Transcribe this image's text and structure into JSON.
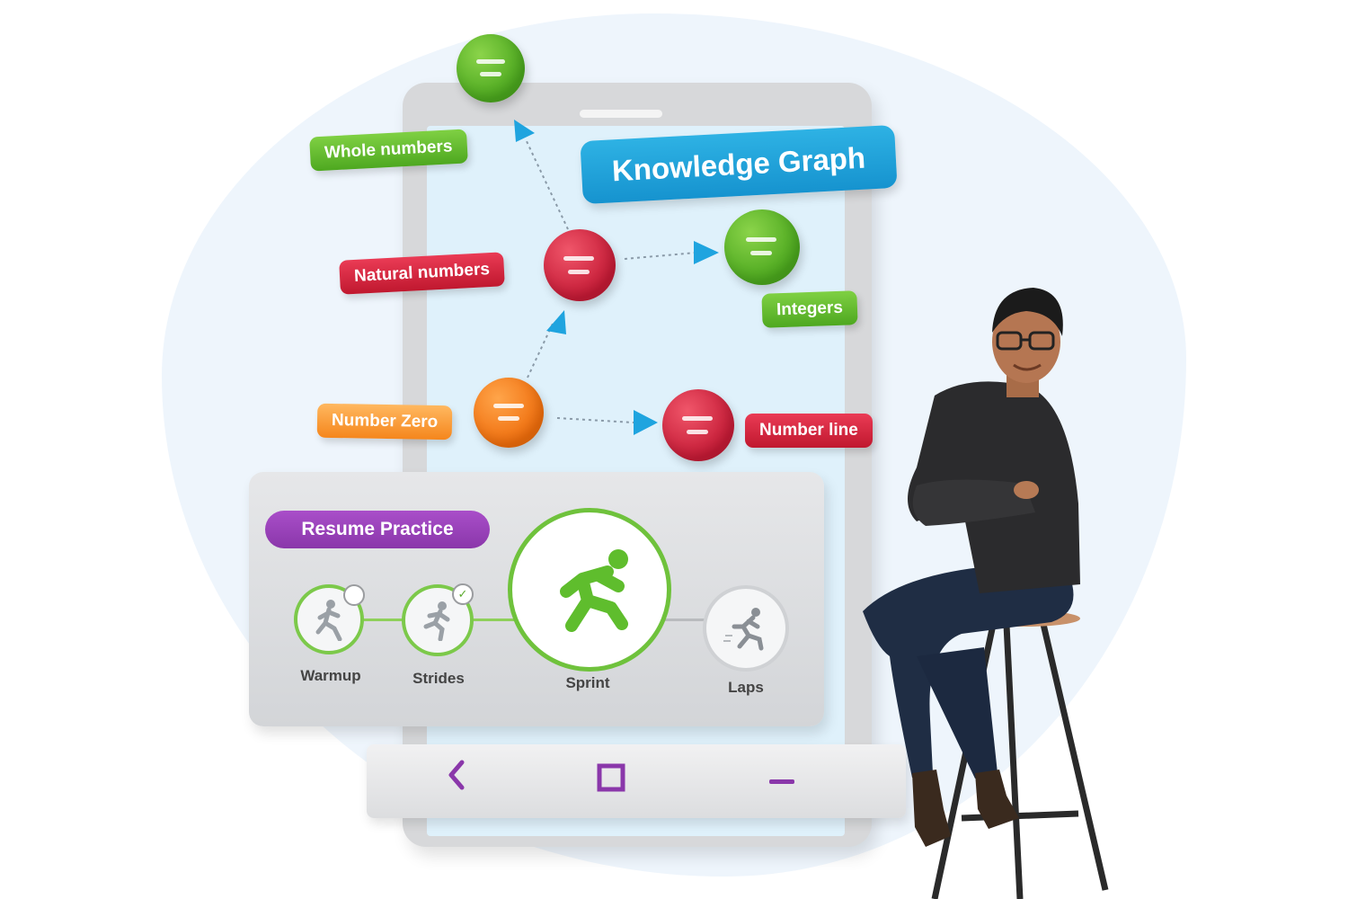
{
  "graph": {
    "title": "Knowledge Graph",
    "nodes": [
      {
        "id": "whole",
        "label": "Whole numbers",
        "color": "#5ab52a"
      },
      {
        "id": "natural",
        "label": "Natural numbers",
        "color": "#d3213c"
      },
      {
        "id": "integers",
        "label": "Integers",
        "color": "#5ab52a"
      },
      {
        "id": "zero",
        "label": "Number Zero",
        "color": "#f28a20"
      },
      {
        "id": "line",
        "label": "Number line",
        "color": "#d3213c"
      }
    ]
  },
  "practice": {
    "resume_label": "Resume Practice",
    "steps": [
      {
        "label": "Warmup",
        "state": "in-progress",
        "icon": "warmup-icon"
      },
      {
        "label": "Strides",
        "state": "completed",
        "icon": "strides-icon"
      },
      {
        "label": "Sprint",
        "state": "current",
        "icon": "sprint-icon"
      },
      {
        "label": "Laps",
        "state": "locked",
        "icon": "laps-icon"
      }
    ]
  },
  "navbar": {
    "back": "back-icon",
    "home": "home-icon",
    "recent": "recent-apps-icon",
    "accent": "#8a37aa"
  },
  "colors": {
    "accent_blue": "#1f9fd9",
    "accent_purple": "#8a37aa",
    "green": "#5ab52a",
    "red": "#d3213c",
    "orange": "#f28a20"
  }
}
